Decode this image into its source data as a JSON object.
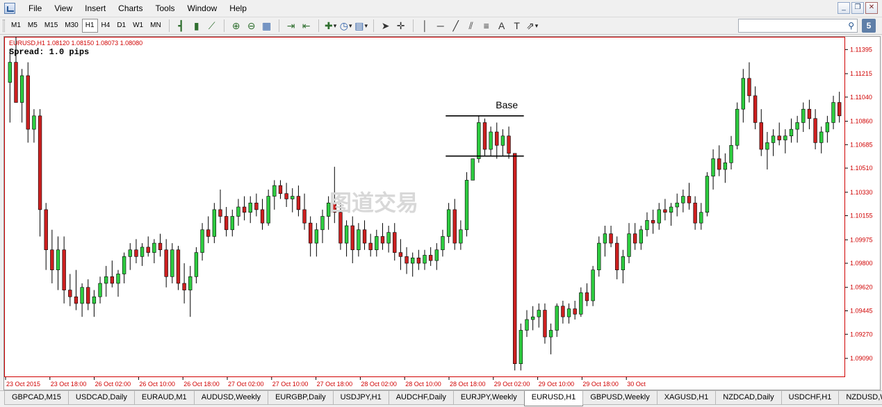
{
  "menu": {
    "items": [
      "File",
      "View",
      "Insert",
      "Charts",
      "Tools",
      "Window",
      "Help"
    ]
  },
  "window_controls": {
    "minimize": "_",
    "restore": "❐",
    "close": "✕"
  },
  "toolbar": {
    "timeframes": [
      "M1",
      "M5",
      "M15",
      "M30",
      "H1",
      "H4",
      "D1",
      "W1",
      "MN"
    ],
    "active_timeframe": "H1",
    "msg_badge": "5"
  },
  "chart": {
    "info": "EURUSD,H1  1.08120 1.08150 1.08073 1.08080",
    "spread": "Spread: 1.0 pips",
    "annotation": "Base",
    "watermark": "图道交易",
    "bull_color": "#2ecc40",
    "bear_color": "#cc2020",
    "border_color": "#d00000"
  },
  "chart_data": {
    "type": "candlestick",
    "symbol": "EURUSD",
    "timeframe": "H1",
    "ylim": [
      1.0895,
      1.1149
    ],
    "y_ticks": [
      "1.11395",
      "1.11215",
      "1.11040",
      "1.10860",
      "1.10685",
      "1.10510",
      "1.10330",
      "1.10155",
      "1.09975",
      "1.09800",
      "1.09620",
      "1.09445",
      "1.09270",
      "1.09090"
    ],
    "x_ticks": [
      "23 Oct 2015",
      "23 Oct 18:00",
      "26 Oct 02:00",
      "26 Oct 10:00",
      "26 Oct 18:00",
      "27 Oct 02:00",
      "27 Oct 10:00",
      "27 Oct 18:00",
      "28 Oct 02:00",
      "28 Oct 10:00",
      "28 Oct 18:00",
      "29 Oct 02:00",
      "29 Oct 10:00",
      "29 Oct 18:00",
      "30 Oct"
    ],
    "base_zone": {
      "high": 1.109,
      "low": 1.106
    },
    "candles": [
      [
        1.1115,
        1.114,
        1.1085,
        1.113
      ],
      [
        1.113,
        1.115,
        1.11,
        1.11
      ],
      [
        1.11,
        1.1125,
        1.1085,
        1.112
      ],
      [
        1.112,
        1.113,
        1.107,
        1.108
      ],
      [
        1.108,
        1.1095,
        1.107,
        1.109
      ],
      [
        1.109,
        1.1095,
        1.1,
        1.102
      ],
      [
        1.102,
        1.1025,
        1.0975,
        1.099
      ],
      [
        1.099,
        1.1005,
        1.0965,
        1.0975
      ],
      [
        1.0975,
        1.1,
        1.096,
        1.099
      ],
      [
        1.099,
        1.1,
        1.095,
        1.096
      ],
      [
        1.096,
        1.0972,
        1.0948,
        1.0955
      ],
      [
        1.0955,
        1.0975,
        1.0945,
        1.095
      ],
      [
        1.095,
        1.0965,
        1.094,
        1.0962
      ],
      [
        1.0962,
        1.0968,
        1.0945,
        1.095
      ],
      [
        1.095,
        1.096,
        1.094,
        1.0955
      ],
      [
        1.0955,
        1.097,
        1.095,
        1.0965
      ],
      [
        1.0965,
        1.0978,
        1.0955,
        1.097
      ],
      [
        1.097,
        1.0982,
        1.0962,
        1.0965
      ],
      [
        1.0965,
        1.0975,
        1.0955,
        1.0972
      ],
      [
        1.0972,
        1.0988,
        1.0965,
        1.0985
      ],
      [
        1.0985,
        1.0995,
        1.0975,
        1.099
      ],
      [
        1.099,
        1.0998,
        1.098,
        1.0985
      ],
      [
        1.0985,
        1.0995,
        1.0978,
        1.0992
      ],
      [
        1.0992,
        1.1,
        1.0985,
        1.0988
      ],
      [
        1.0988,
        1.0998,
        1.098,
        1.0995
      ],
      [
        1.0995,
        1.1002,
        1.0985,
        1.099
      ],
      [
        1.099,
        1.0998,
        1.0962,
        1.097
      ],
      [
        1.097,
        1.0995,
        1.0965,
        1.099
      ],
      [
        1.099,
        1.0993,
        1.096,
        1.0965
      ],
      [
        1.0965,
        1.098,
        1.095,
        1.096
      ],
      [
        1.096,
        1.0978,
        1.094,
        1.097
      ],
      [
        1.097,
        1.0992,
        1.0965,
        1.0988
      ],
      [
        1.0988,
        1.101,
        1.0982,
        1.1005
      ],
      [
        1.1005,
        1.1015,
        1.0995,
        1.1
      ],
      [
        1.1,
        1.1025,
        1.0995,
        1.102
      ],
      [
        1.102,
        1.1035,
        1.101,
        1.1015
      ],
      [
        1.1015,
        1.1022,
        1.1,
        1.1005
      ],
      [
        1.1005,
        1.102,
        1.1,
        1.1015
      ],
      [
        1.1015,
        1.1028,
        1.1008,
        1.1022
      ],
      [
        1.1022,
        1.103,
        1.1012,
        1.1018
      ],
      [
        1.1018,
        1.103,
        1.101,
        1.1025
      ],
      [
        1.1025,
        1.1032,
        1.1015,
        1.102
      ],
      [
        1.102,
        1.1028,
        1.1005,
        1.101
      ],
      [
        1.101,
        1.1035,
        1.1008,
        1.103
      ],
      [
        1.103,
        1.1042,
        1.102,
        1.1038
      ],
      [
        1.1038,
        1.1042,
        1.1028,
        1.1032
      ],
      [
        1.1032,
        1.104,
        1.1022,
        1.1028
      ],
      [
        1.1028,
        1.1036,
        1.1018,
        1.103
      ],
      [
        1.103,
        1.1038,
        1.1015,
        1.102
      ],
      [
        1.102,
        1.1032,
        1.1005,
        1.101
      ],
      [
        1.101,
        1.1015,
        1.0985,
        1.0995
      ],
      [
        1.0995,
        1.101,
        1.0985,
        1.1005
      ],
      [
        1.1005,
        1.102,
        1.0995,
        1.1015
      ],
      [
        1.1015,
        1.103,
        1.1005,
        1.1025
      ],
      [
        1.1025,
        1.1052,
        1.101,
        1.1018
      ],
      [
        1.1018,
        1.1025,
        1.099,
        1.0995
      ],
      [
        1.0995,
        1.1012,
        1.0985,
        1.1008
      ],
      [
        1.1008,
        1.1015,
        1.098,
        1.099
      ],
      [
        1.099,
        1.101,
        1.0985,
        1.1005
      ],
      [
        1.1005,
        1.1012,
        1.099,
        1.0995
      ],
      [
        1.0995,
        1.1002,
        1.0985,
        1.099
      ],
      [
        1.099,
        1.1005,
        1.0985,
        1.1
      ],
      [
        1.1,
        1.101,
        1.099,
        1.0995
      ],
      [
        1.0995,
        1.1008,
        1.0988,
        1.1003
      ],
      [
        1.1003,
        1.101,
        1.0982,
        1.0988
      ],
      [
        1.0988,
        1.0998,
        1.0975,
        1.0985
      ],
      [
        1.0985,
        1.0992,
        1.0972,
        1.098
      ],
      [
        1.098,
        1.0988,
        1.097,
        1.0984
      ],
      [
        1.0984,
        1.099,
        1.0975,
        1.098
      ],
      [
        1.098,
        1.099,
        1.0975,
        1.0986
      ],
      [
        1.0986,
        1.0992,
        1.0978,
        1.0982
      ],
      [
        1.0982,
        1.0995,
        1.0975,
        1.099
      ],
      [
        1.099,
        1.1005,
        1.0985,
        1.1
      ],
      [
        1.1,
        1.1025,
        1.0995,
        1.102
      ],
      [
        1.102,
        1.1028,
        1.099,
        1.0995
      ],
      [
        1.0995,
        1.1012,
        1.099,
        1.1005
      ],
      [
        1.1005,
        1.1048,
        1.1,
        1.1042
      ],
      [
        1.1042,
        1.105,
        1.1055,
        1.1058
      ],
      [
        1.1058,
        1.109,
        1.1055,
        1.1085
      ],
      [
        1.1085,
        1.1088,
        1.106,
        1.1065
      ],
      [
        1.1065,
        1.1082,
        1.106,
        1.1078
      ],
      [
        1.1078,
        1.1085,
        1.1058,
        1.1068
      ],
      [
        1.1068,
        1.108,
        1.106,
        1.1075
      ],
      [
        1.1075,
        1.1082,
        1.1058,
        1.1062
      ],
      [
        1.1062,
        1.1062,
        1.09,
        1.0905
      ],
      [
        1.0905,
        1.0935,
        1.09,
        1.093
      ],
      [
        1.093,
        1.0945,
        1.0925,
        1.0938
      ],
      [
        1.0938,
        1.0948,
        1.093,
        1.094
      ],
      [
        1.094,
        1.095,
        1.0932,
        1.0945
      ],
      [
        1.0945,
        1.095,
        1.092,
        1.0925
      ],
      [
        1.0925,
        1.0935,
        1.0912,
        1.093
      ],
      [
        1.093,
        1.095,
        1.0925,
        1.0948
      ],
      [
        1.0948,
        1.0952,
        1.0935,
        1.094
      ],
      [
        1.094,
        1.095,
        1.0935,
        1.0946
      ],
      [
        1.0946,
        1.0952,
        1.0938,
        1.0942
      ],
      [
        1.0942,
        1.0962,
        1.094,
        1.0958
      ],
      [
        1.0958,
        1.0965,
        1.0948,
        1.0952
      ],
      [
        1.0952,
        1.0978,
        1.0948,
        1.0975
      ],
      [
        1.0975,
        1.1,
        1.097,
        1.0995
      ],
      [
        1.0995,
        1.1008,
        1.0985,
        1.1002
      ],
      [
        1.1002,
        1.1008,
        1.0992,
        1.0995
      ],
      [
        1.0995,
        1.1,
        1.0968,
        1.0975
      ],
      [
        1.0975,
        1.099,
        1.0965,
        1.0985
      ],
      [
        1.0985,
        1.101,
        1.098,
        1.1002
      ],
      [
        1.1002,
        1.101,
        1.099,
        1.0995
      ],
      [
        1.0995,
        1.1008,
        1.099,
        1.1005
      ],
      [
        1.1005,
        1.1018,
        1.1,
        1.1012
      ],
      [
        1.1012,
        1.102,
        1.1002,
        1.101
      ],
      [
        1.101,
        1.1025,
        1.1005,
        1.102
      ],
      [
        1.102,
        1.1028,
        1.1012,
        1.1018
      ],
      [
        1.1018,
        1.1025,
        1.1008,
        1.1022
      ],
      [
        1.1022,
        1.1032,
        1.1015,
        1.1025
      ],
      [
        1.1025,
        1.1035,
        1.1018,
        1.103
      ],
      [
        1.103,
        1.104,
        1.102,
        1.1025
      ],
      [
        1.1025,
        1.103,
        1.1005,
        1.101
      ],
      [
        1.101,
        1.1025,
        1.1005,
        1.1018
      ],
      [
        1.1018,
        1.1048,
        1.1015,
        1.1045
      ],
      [
        1.1045,
        1.1065,
        1.1035,
        1.1058
      ],
      [
        1.1058,
        1.1068,
        1.1045,
        1.105
      ],
      [
        1.105,
        1.1062,
        1.104,
        1.1055
      ],
      [
        1.1055,
        1.1075,
        1.105,
        1.1068
      ],
      [
        1.1068,
        1.11,
        1.1065,
        1.1095
      ],
      [
        1.1095,
        1.1125,
        1.1085,
        1.1118
      ],
      [
        1.1118,
        1.113,
        1.11,
        1.1105
      ],
      [
        1.1105,
        1.1112,
        1.108,
        1.1085
      ],
      [
        1.1085,
        1.1095,
        1.106,
        1.1065
      ],
      [
        1.1065,
        1.1078,
        1.105,
        1.107
      ],
      [
        1.107,
        1.108,
        1.106,
        1.1075
      ],
      [
        1.1075,
        1.1085,
        1.1068,
        1.1072
      ],
      [
        1.1072,
        1.108,
        1.1062,
        1.1075
      ],
      [
        1.1075,
        1.1088,
        1.107,
        1.108
      ],
      [
        1.108,
        1.109,
        1.107,
        1.1085
      ],
      [
        1.1085,
        1.11,
        1.1078,
        1.1095
      ],
      [
        1.1095,
        1.1102,
        1.108,
        1.1088
      ],
      [
        1.1088,
        1.1095,
        1.1065,
        1.107
      ],
      [
        1.107,
        1.1082,
        1.1062,
        1.1078
      ],
      [
        1.1078,
        1.109,
        1.107,
        1.1085
      ],
      [
        1.1085,
        1.1105,
        1.108,
        1.11
      ],
      [
        1.11,
        1.1108,
        1.1085,
        1.109
      ]
    ]
  },
  "tabs": [
    "GBPCAD,M15",
    "USDCAD,Daily",
    "EURAUD,M1",
    "AUDUSD,Weekly",
    "EURGBP,Daily",
    "USDJPY,H1",
    "AUDCHF,Daily",
    "EURJPY,Weekly",
    "EURUSD,H1",
    "GBPUSD,Weekly",
    "XAGUSD,H1",
    "NZDCAD,Daily",
    "USDCHF,H1",
    "NZDUSD,We"
  ],
  "active_tab": "EURUSD,H1"
}
